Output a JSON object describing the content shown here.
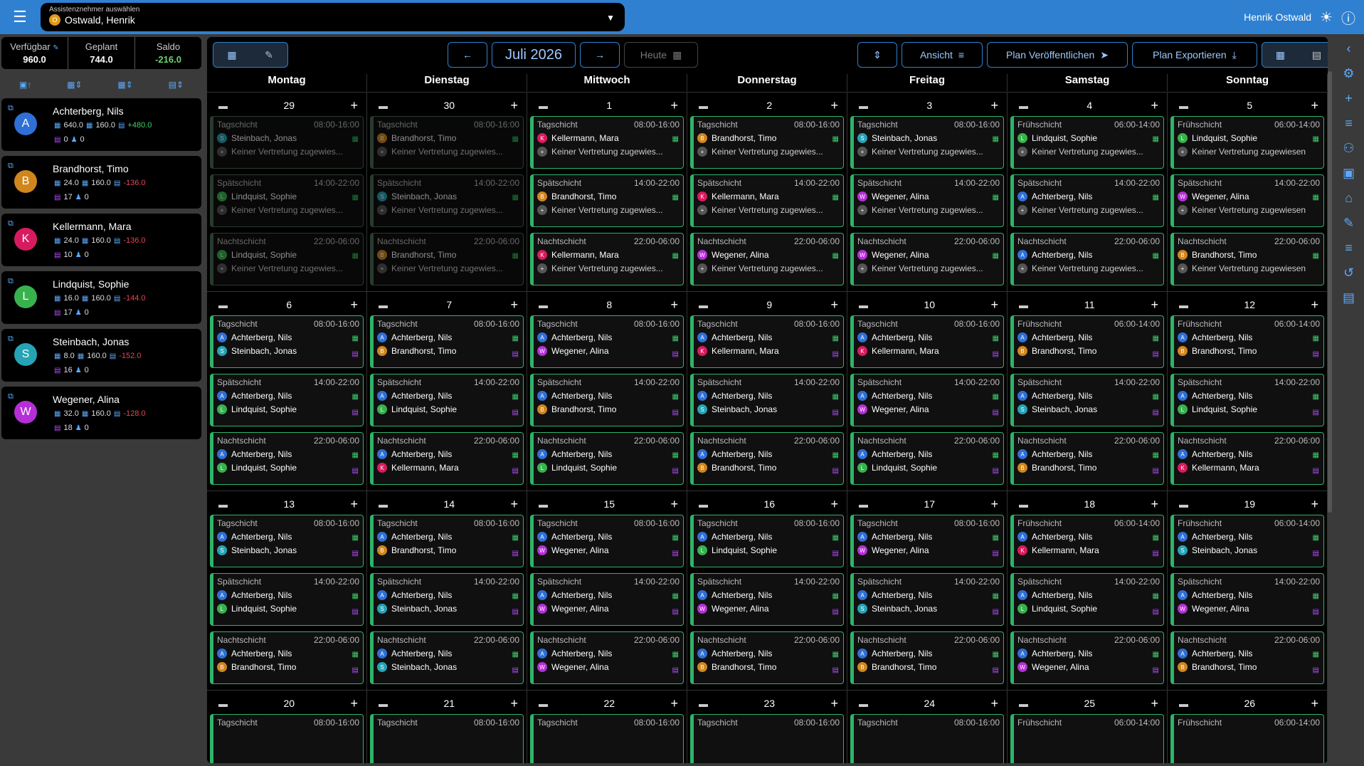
{
  "topbar": {
    "selector_label": "Assistenznehmer auswählen",
    "selector_value": "Ostwald, Henrik",
    "selector_initial": "O",
    "user": "Henrik Ostwald"
  },
  "stats": {
    "avail_label": "Verfügbar",
    "avail": "960.0",
    "planned_label": "Geplant",
    "planned": "744.0",
    "saldo_label": "Saldo",
    "saldo": "-216.0"
  },
  "persons": [
    {
      "name": "Achterberg, Nils",
      "initial": "A",
      "color": "#2f6fd6",
      "hours": "640.0",
      "target": "160.0",
      "diff": "+480.0",
      "diffpos": true,
      "p": "0",
      "f": "0"
    },
    {
      "name": "Brandhorst, Timo",
      "initial": "B",
      "color": "#d1861c",
      "hours": "24.0",
      "target": "160.0",
      "diff": "-136.0",
      "diffpos": false,
      "p": "17",
      "f": "0"
    },
    {
      "name": "Kellermann, Mara",
      "initial": "K",
      "color": "#d81b60",
      "hours": "24.0",
      "target": "160.0",
      "diff": "-136.0",
      "diffpos": false,
      "p": "10",
      "f": "0"
    },
    {
      "name": "Lindquist, Sophie",
      "initial": "L",
      "color": "#37b24d",
      "hours": "16.0",
      "target": "160.0",
      "diff": "-144.0",
      "diffpos": false,
      "p": "17",
      "f": "0"
    },
    {
      "name": "Steinbach, Jonas",
      "initial": "S",
      "color": "#26a3b5",
      "hours": "8.0",
      "target": "160.0",
      "diff": "-152.0",
      "diffpos": false,
      "p": "16",
      "f": "0"
    },
    {
      "name": "Wegener, Alina",
      "initial": "W",
      "color": "#b52fd6",
      "hours": "32.0",
      "target": "160.0",
      "diff": "-128.0",
      "diffpos": false,
      "p": "18",
      "f": "0"
    }
  ],
  "toolbar": {
    "month": "Juli 2026",
    "today": "Heute",
    "view": "Ansicht",
    "publish": "Plan Veröffentlichen",
    "export": "Plan Exportieren"
  },
  "weekdays": [
    "Montag",
    "Dienstag",
    "Mittwoch",
    "Donnerstag",
    "Freitag",
    "Samstag",
    "Sonntag"
  ],
  "no_sub": "Keiner Vertretung zugewies...",
  "no_sub_full": "Keiner Vertretung zugewiesen",
  "weeks": [
    {
      "days": [
        {
          "d": "29",
          "dim": true,
          "shifts": [
            [
              "Tagschicht",
              "08:00-16:00",
              "Steinbach, Jonas",
              null
            ],
            [
              "Spätschicht",
              "14:00-22:00",
              "Lindquist, Sophie",
              null
            ],
            [
              "Nachtschicht",
              "22:00-06:00",
              "Lindquist, Sophie",
              null
            ]
          ]
        },
        {
          "d": "30",
          "dim": true,
          "shifts": [
            [
              "Tagschicht",
              "08:00-16:00",
              "Brandhorst, Timo",
              null
            ],
            [
              "Spätschicht",
              "14:00-22:00",
              "Steinbach, Jonas",
              null
            ],
            [
              "Nachtschicht",
              "22:00-06:00",
              "Brandhorst, Timo",
              null
            ]
          ]
        },
        {
          "d": "1",
          "shifts": [
            [
              "Tagschicht",
              "08:00-16:00",
              "Kellermann, Mara",
              null
            ],
            [
              "Spätschicht",
              "14:00-22:00",
              "Brandhorst, Timo",
              null
            ],
            [
              "Nachtschicht",
              "22:00-06:00",
              "Kellermann, Mara",
              null
            ]
          ]
        },
        {
          "d": "2",
          "shifts": [
            [
              "Tagschicht",
              "08:00-16:00",
              "Brandhorst, Timo",
              null
            ],
            [
              "Spätschicht",
              "14:00-22:00",
              "Kellermann, Mara",
              null
            ],
            [
              "Nachtschicht",
              "22:00-06:00",
              "Wegener, Alina",
              null
            ]
          ]
        },
        {
          "d": "3",
          "shifts": [
            [
              "Tagschicht",
              "08:00-16:00",
              "Steinbach, Jonas",
              null
            ],
            [
              "Spätschicht",
              "14:00-22:00",
              "Wegener, Alina",
              null
            ],
            [
              "Nachtschicht",
              "22:00-06:00",
              "Wegener, Alina",
              null
            ]
          ]
        },
        {
          "d": "4",
          "shifts": [
            [
              "Frühschicht",
              "06:00-14:00",
              "Lindquist, Sophie",
              null
            ],
            [
              "Spätschicht",
              "14:00-22:00",
              "Achterberg, Nils",
              null
            ],
            [
              "Nachtschicht",
              "22:00-06:00",
              "Achterberg, Nils",
              null
            ]
          ]
        },
        {
          "d": "5",
          "full": true,
          "shifts": [
            [
              "Frühschicht",
              "06:00-14:00",
              "Lindquist, Sophie",
              null
            ],
            [
              "Spätschicht",
              "14:00-22:00",
              "Wegener, Alina",
              null
            ],
            [
              "Nachtschicht",
              "22:00-06:00",
              "Brandhorst, Timo",
              null
            ]
          ]
        }
      ]
    },
    {
      "days": [
        {
          "d": "6",
          "shifts": [
            [
              "Tagschicht",
              "08:00-16:00",
              "Achterberg, Nils",
              "Steinbach, Jonas"
            ],
            [
              "Spätschicht",
              "14:00-22:00",
              "Achterberg, Nils",
              "Lindquist, Sophie"
            ],
            [
              "Nachtschicht",
              "22:00-06:00",
              "Achterberg, Nils",
              "Lindquist, Sophie"
            ]
          ]
        },
        {
          "d": "7",
          "shifts": [
            [
              "Tagschicht",
              "08:00-16:00",
              "Achterberg, Nils",
              "Brandhorst, Timo"
            ],
            [
              "Spätschicht",
              "14:00-22:00",
              "Achterberg, Nils",
              "Lindquist, Sophie"
            ],
            [
              "Nachtschicht",
              "22:00-06:00",
              "Achterberg, Nils",
              "Kellermann, Mara"
            ]
          ]
        },
        {
          "d": "8",
          "shifts": [
            [
              "Tagschicht",
              "08:00-16:00",
              "Achterberg, Nils",
              "Wegener, Alina"
            ],
            [
              "Spätschicht",
              "14:00-22:00",
              "Achterberg, Nils",
              "Brandhorst, Timo"
            ],
            [
              "Nachtschicht",
              "22:00-06:00",
              "Achterberg, Nils",
              "Lindquist, Sophie"
            ]
          ]
        },
        {
          "d": "9",
          "shifts": [
            [
              "Tagschicht",
              "08:00-16:00",
              "Achterberg, Nils",
              "Kellermann, Mara"
            ],
            [
              "Spätschicht",
              "14:00-22:00",
              "Achterberg, Nils",
              "Steinbach, Jonas"
            ],
            [
              "Nachtschicht",
              "22:00-06:00",
              "Achterberg, Nils",
              "Brandhorst, Timo"
            ]
          ]
        },
        {
          "d": "10",
          "shifts": [
            [
              "Tagschicht",
              "08:00-16:00",
              "Achterberg, Nils",
              "Kellermann, Mara"
            ],
            [
              "Spätschicht",
              "14:00-22:00",
              "Achterberg, Nils",
              "Wegener, Alina"
            ],
            [
              "Nachtschicht",
              "22:00-06:00",
              "Achterberg, Nils",
              "Lindquist, Sophie"
            ]
          ]
        },
        {
          "d": "11",
          "shifts": [
            [
              "Frühschicht",
              "06:00-14:00",
              "Achterberg, Nils",
              "Brandhorst, Timo"
            ],
            [
              "Spätschicht",
              "14:00-22:00",
              "Achterberg, Nils",
              "Steinbach, Jonas"
            ],
            [
              "Nachtschicht",
              "22:00-06:00",
              "Achterberg, Nils",
              "Brandhorst, Timo"
            ]
          ]
        },
        {
          "d": "12",
          "shifts": [
            [
              "Frühschicht",
              "06:00-14:00",
              "Achterberg, Nils",
              "Brandhorst, Timo"
            ],
            [
              "Spätschicht",
              "14:00-22:00",
              "Achterberg, Nils",
              "Lindquist, Sophie"
            ],
            [
              "Nachtschicht",
              "22:00-06:00",
              "Achterberg, Nils",
              "Kellermann, Mara"
            ]
          ]
        }
      ]
    },
    {
      "days": [
        {
          "d": "13",
          "shifts": [
            [
              "Tagschicht",
              "08:00-16:00",
              "Achterberg, Nils",
              "Steinbach, Jonas"
            ],
            [
              "Spätschicht",
              "14:00-22:00",
              "Achterberg, Nils",
              "Lindquist, Sophie"
            ],
            [
              "Nachtschicht",
              "22:00-06:00",
              "Achterberg, Nils",
              "Brandhorst, Timo"
            ]
          ]
        },
        {
          "d": "14",
          "shifts": [
            [
              "Tagschicht",
              "08:00-16:00",
              "Achterberg, Nils",
              "Brandhorst, Timo"
            ],
            [
              "Spätschicht",
              "14:00-22:00",
              "Achterberg, Nils",
              "Steinbach, Jonas"
            ],
            [
              "Nachtschicht",
              "22:00-06:00",
              "Achterberg, Nils",
              "Steinbach, Jonas"
            ]
          ]
        },
        {
          "d": "15",
          "shifts": [
            [
              "Tagschicht",
              "08:00-16:00",
              "Achterberg, Nils",
              "Wegener, Alina"
            ],
            [
              "Spätschicht",
              "14:00-22:00",
              "Achterberg, Nils",
              "Wegener, Alina"
            ],
            [
              "Nachtschicht",
              "22:00-06:00",
              "Achterberg, Nils",
              "Wegener, Alina"
            ]
          ]
        },
        {
          "d": "16",
          "shifts": [
            [
              "Tagschicht",
              "08:00-16:00",
              "Achterberg, Nils",
              "Lindquist, Sophie"
            ],
            [
              "Spätschicht",
              "14:00-22:00",
              "Achterberg, Nils",
              "Wegener, Alina"
            ],
            [
              "Nachtschicht",
              "22:00-06:00",
              "Achterberg, Nils",
              "Brandhorst, Timo"
            ]
          ]
        },
        {
          "d": "17",
          "shifts": [
            [
              "Tagschicht",
              "08:00-16:00",
              "Achterberg, Nils",
              "Wegener, Alina"
            ],
            [
              "Spätschicht",
              "14:00-22:00",
              "Achterberg, Nils",
              "Steinbach, Jonas"
            ],
            [
              "Nachtschicht",
              "22:00-06:00",
              "Achterberg, Nils",
              "Brandhorst, Timo"
            ]
          ]
        },
        {
          "d": "18",
          "shifts": [
            [
              "Frühschicht",
              "06:00-14:00",
              "Achterberg, Nils",
              "Kellermann, Mara"
            ],
            [
              "Spätschicht",
              "14:00-22:00",
              "Achterberg, Nils",
              "Lindquist, Sophie"
            ],
            [
              "Nachtschicht",
              "22:00-06:00",
              "Achterberg, Nils",
              "Wegener, Alina"
            ]
          ]
        },
        {
          "d": "19",
          "shifts": [
            [
              "Frühschicht",
              "06:00-14:00",
              "Achterberg, Nils",
              "Steinbach, Jonas"
            ],
            [
              "Spätschicht",
              "14:00-22:00",
              "Achterberg, Nils",
              "Wegener, Alina"
            ],
            [
              "Nachtschicht",
              "22:00-06:00",
              "Achterberg, Nils",
              "Brandhorst, Timo"
            ]
          ]
        }
      ]
    },
    {
      "days": [
        {
          "d": "20",
          "shifts": [
            [
              "Tagschicht",
              "08:00-16:00",
              null,
              null
            ]
          ]
        },
        {
          "d": "21",
          "shifts": [
            [
              "Tagschicht",
              "08:00-16:00",
              null,
              null
            ]
          ]
        },
        {
          "d": "22",
          "shifts": [
            [
              "Tagschicht",
              "08:00-16:00",
              null,
              null
            ]
          ]
        },
        {
          "d": "23",
          "shifts": [
            [
              "Tagschicht",
              "08:00-16:00",
              null,
              null
            ]
          ]
        },
        {
          "d": "24",
          "shifts": [
            [
              "Tagschicht",
              "08:00-16:00",
              null,
              null
            ]
          ]
        },
        {
          "d": "25",
          "shifts": [
            [
              "Frühschicht",
              "06:00-14:00",
              null,
              null
            ]
          ]
        },
        {
          "d": "26",
          "shifts": [
            [
              "Frühschicht",
              "06:00-14:00",
              null,
              null
            ]
          ]
        }
      ]
    }
  ]
}
